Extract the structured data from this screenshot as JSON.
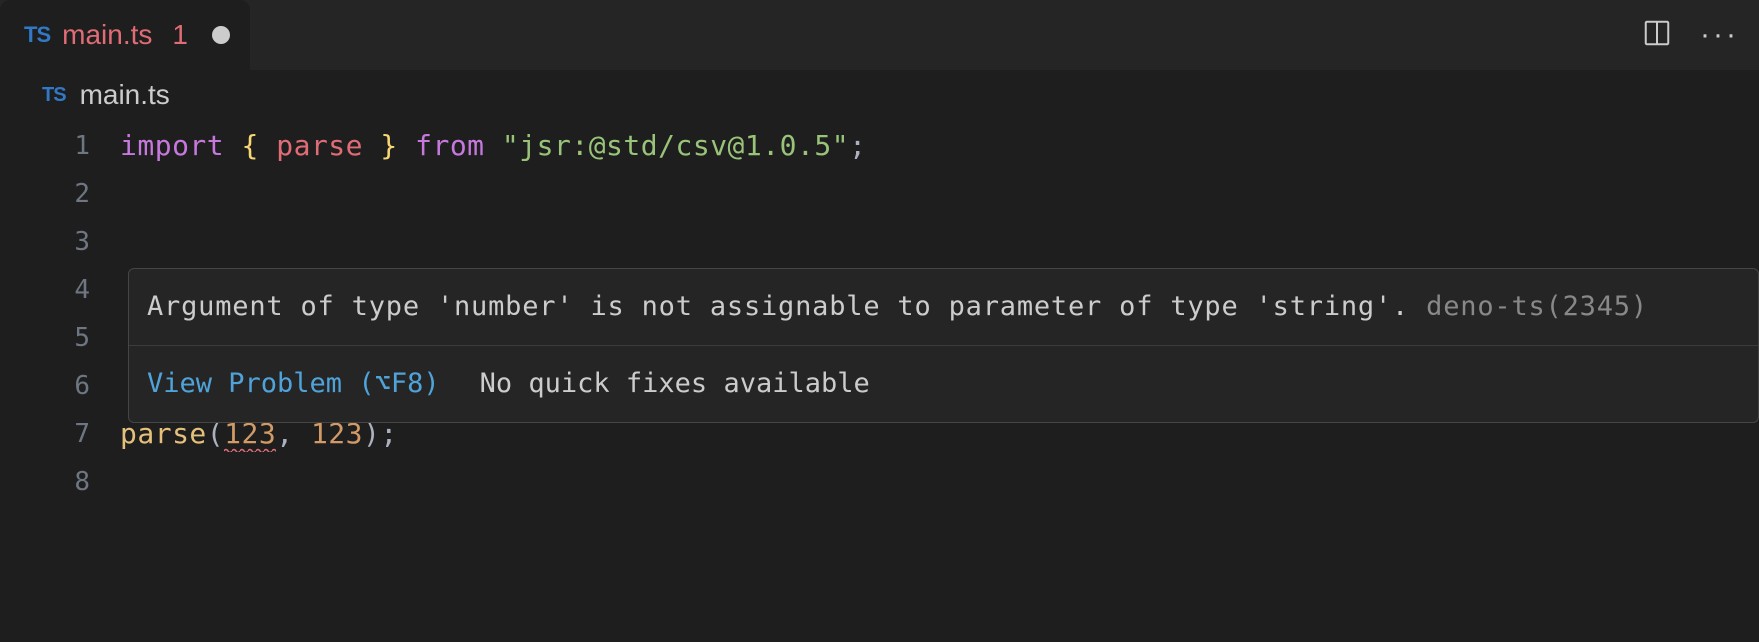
{
  "tab": {
    "filename": "main.ts",
    "badge": "1",
    "filetype_icon": "TS"
  },
  "breadcrumb": {
    "filetype_icon": "TS",
    "filename": "main.ts"
  },
  "code": {
    "lines": [
      "1",
      "2",
      "3",
      "4",
      "5",
      "6",
      "7",
      "8"
    ],
    "line1": {
      "import": "import",
      "lbrace": "{",
      "identifier": "parse",
      "rbrace": "}",
      "from": "from",
      "path": "\"jsr:@std/csv@1.0.5\"",
      "semi": ";"
    },
    "line7": {
      "fn": "parse",
      "lparen": "(",
      "arg1": "123",
      "comma": ",",
      "arg2": "123",
      "rparen": ")",
      "semi": ";"
    }
  },
  "hover": {
    "message": "Argument of type 'number' is not assignable to parameter of type 'string'.",
    "error_code": "deno-ts(2345)",
    "view_problem_label": "View Problem (⌥F8)",
    "no_fixes_label": "No quick fixes available"
  }
}
